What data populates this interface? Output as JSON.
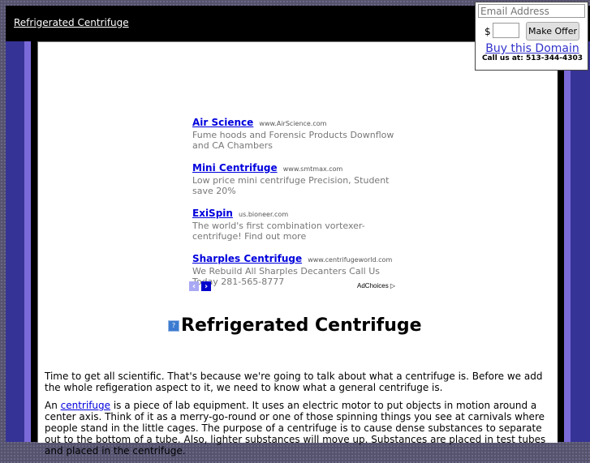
{
  "header": {
    "site_title": "Refrigerated Centrifuge"
  },
  "offer": {
    "email_placeholder": "Email Address",
    "currency_symbol": "$",
    "amount_value": "",
    "make_offer_label": "Make Offer",
    "buy_domain_label": "Buy this Domain",
    "call_us": "Call us at: 513-344-4303"
  },
  "ads": {
    "items": [
      {
        "title": "Air Science",
        "url": "www.AirScience.com",
        "desc": "Fume hoods and Forensic Products Downflow and CA Chambers"
      },
      {
        "title": "Mini Centrifuge",
        "url": "www.smtmax.com",
        "desc": "Low price mini centrifuge Precision, Student save 20%"
      },
      {
        "title": "ExiSpin",
        "url": "us.bioneer.com",
        "desc": "The world's first combination vortexer-centrifuge! Find out more"
      },
      {
        "title": "Sharples Centrifuge",
        "url": "www.centrifugeworld.com",
        "desc": "We Rebuild All Sharples Decanters Call Us Today 281-565-8777"
      }
    ],
    "prev_icon": "chevron-left-icon",
    "next_icon": "chevron-right-icon",
    "prev_glyph": "‹",
    "next_glyph": "›",
    "adchoices_label": "AdChoices ▷"
  },
  "page": {
    "heading": "Refrigerated Centrifuge",
    "heading_icon": "?",
    "paragraph1": "Time to get all scientific.  That's because we're going to talk about what a centrifuge is.  Before we add the whole refigeration aspect to it, we need to know what a general centrifuge is.",
    "paragraph2_prefix": "An ",
    "paragraph2_link": "centrifuge",
    "paragraph2_rest": " is a piece of lab equipment.  It uses an electric motor to put objects in motion around a center axis.  Think of it as a merry-go-round or one of those spinning things you see at carnivals where people stand in the little cages.  The purpose of a centrifuge is to cause dense substances to separate out to the bottom of a tube.  Also, lighter substances will move up.  Substances are placed in test tubes and placed in the centrifuge."
  }
}
